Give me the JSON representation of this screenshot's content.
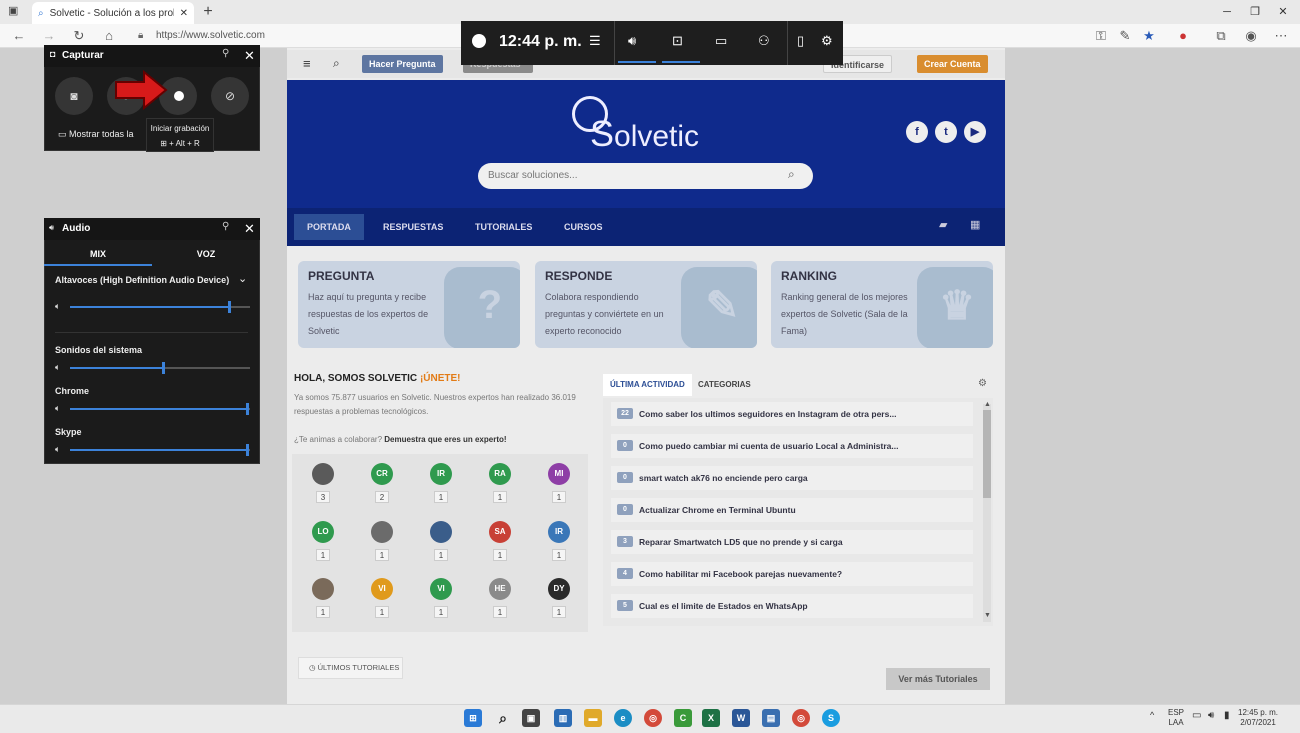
{
  "browser": {
    "tab_title": "Solvetic - Solución a los problem",
    "url": "https://www.solvetic.com"
  },
  "site": {
    "topbar": {
      "ask_label": "Hacer Pregunta",
      "answers_label": "Respuestas",
      "login_label": "Identificarse",
      "signup_label": "Crear Cuenta"
    },
    "logo_text": "olvetic",
    "search_placeholder": "Buscar soluciones...",
    "nav": [
      "PORTADA",
      "RESPUESTAS",
      "TUTORIALES",
      "CURSOS"
    ],
    "cards": [
      {
        "title": "PREGUNTA",
        "text": "Haz aquí tu pregunta y recibe respuestas de los expertos de Solvetic"
      },
      {
        "title": "RESPONDE",
        "text": "Colabora respondiendo preguntas y conviértete en un experto reconocido"
      },
      {
        "title": "RANKING",
        "text": "Ranking general de los mejores expertos de Solvetic (Sala de la Fama)"
      }
    ],
    "hola_title": "HOLA, SOMOS SOLVETIC",
    "hola_join": "¡ÚNETE!",
    "hola_text": "Ya somos 75.877 usuarios en Solvetic. Nuestros expertos han realizado 36.019 respuestas a problemas tecnológicos.",
    "hola_question": "¿Te animas a colaborar?",
    "hola_expert": "Demuestra que eres un experto!",
    "users": [
      {
        "initials": "",
        "count": "3",
        "color": "#5a5a5a"
      },
      {
        "initials": "CR",
        "count": "2",
        "color": "#2f9a4e"
      },
      {
        "initials": "IR",
        "count": "1",
        "color": "#2f9a4e"
      },
      {
        "initials": "RA",
        "count": "1",
        "color": "#2f9a4e"
      },
      {
        "initials": "MI",
        "count": "1",
        "color": "#8e3ea6"
      },
      {
        "initials": "LO",
        "count": "1",
        "color": "#2f9a4e"
      },
      {
        "initials": "",
        "count": "1",
        "color": "#6b6b6b"
      },
      {
        "initials": "",
        "count": "1",
        "color": "#3a5d8a"
      },
      {
        "initials": "SA",
        "count": "1",
        "color": "#c84036"
      },
      {
        "initials": "IR",
        "count": "1",
        "color": "#3a77b8"
      },
      {
        "initials": "",
        "count": "1",
        "color": "#7a6a5a"
      },
      {
        "initials": "VI",
        "count": "1",
        "color": "#e09a1c"
      },
      {
        "initials": "VI",
        "count": "1",
        "color": "#2f9a4e"
      },
      {
        "initials": "HE",
        "count": "1",
        "color": "#8a8a8a"
      },
      {
        "initials": "DY",
        "count": "1",
        "color": "#2b2b2b"
      }
    ],
    "activity_tabs": [
      "ÚLTIMA ACTIVIDAD",
      "CATEGORIAS"
    ],
    "activity": [
      {
        "count": "22",
        "title": "Como saber los ultimos seguidores en Instagram de otra pers..."
      },
      {
        "count": "0",
        "title": "Como puedo cambiar mi cuenta de usuario Local a Administra..."
      },
      {
        "count": "0",
        "title": "smart watch ak76 no enciende pero carga"
      },
      {
        "count": "0",
        "title": "Actualizar Chrome en Terminal Ubuntu"
      },
      {
        "count": "3",
        "title": "Reparar Smartwatch LD5 que no prende y si carga"
      },
      {
        "count": "4",
        "title": "Como habilitar mi Facebook parejas nuevamente?"
      },
      {
        "count": "5",
        "title": "Cual es el limite de Estados en WhatsApp"
      }
    ],
    "ultimos_label": "ÚLTIMOS TUTORIALES",
    "vermas_label": "Ver más Tutoriales"
  },
  "xbox": {
    "time": "12:44 p. m."
  },
  "capture": {
    "title": "Capturar",
    "tooltip_title": "Iniciar grabación",
    "tooltip_shortcut": "+ Alt + R",
    "show_all": "Mostrar todas la"
  },
  "audio": {
    "title": "Audio",
    "tabs": [
      "MIX",
      "VOZ"
    ],
    "device": "Altavoces (High Definition Audio Device)",
    "apps": [
      {
        "name": "Sonidos del sistema",
        "level": 0.52
      },
      {
        "name": "Chrome",
        "level": 1.0
      },
      {
        "name": "Skype",
        "level": 1.0
      }
    ],
    "master_level": 0.9
  },
  "taskbar": {
    "lang1": "ESP",
    "lang2": "LAA",
    "time": "12:45 p. m.",
    "date": "2/07/2021"
  }
}
